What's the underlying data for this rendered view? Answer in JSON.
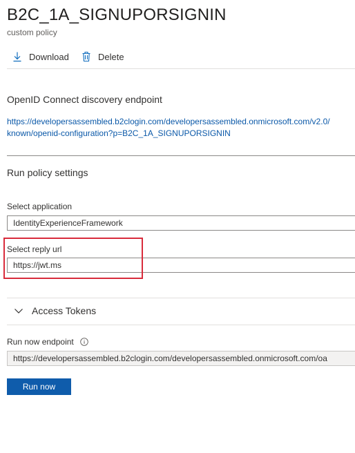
{
  "header": {
    "title": "B2C_1A_SIGNUPORSIGNIN",
    "subtitle": "custom policy"
  },
  "toolbar": {
    "download_label": "Download",
    "delete_label": "Delete"
  },
  "discovery": {
    "heading": "OpenID Connect discovery endpoint",
    "link_line1": "https://developersassembled.b2clogin.com/developersassembled.onmicrosoft.com/v2.0/",
    "link_line2": "known/openid-configuration?p=B2C_1A_SIGNUPORSIGNIN"
  },
  "run_policy": {
    "heading": "Run policy settings",
    "application_label": "Select application",
    "application_value": "IdentityExperienceFramework",
    "reply_url_label": "Select reply url",
    "reply_url_value": "https://jwt.ms",
    "access_tokens_label": "Access Tokens",
    "endpoint_label": "Run now endpoint",
    "endpoint_value": "https://developersassembled.b2clogin.com/developersassembled.onmicrosoft.com/oa",
    "run_now_label": "Run now"
  },
  "icons": {
    "download": "download-icon",
    "delete": "trash-icon",
    "expander": "chevron-down-icon",
    "info": "info-icon"
  },
  "colors": {
    "link": "#0a58a8",
    "primary_button": "#0f5cab",
    "highlight_border": "#d82a3a"
  }
}
